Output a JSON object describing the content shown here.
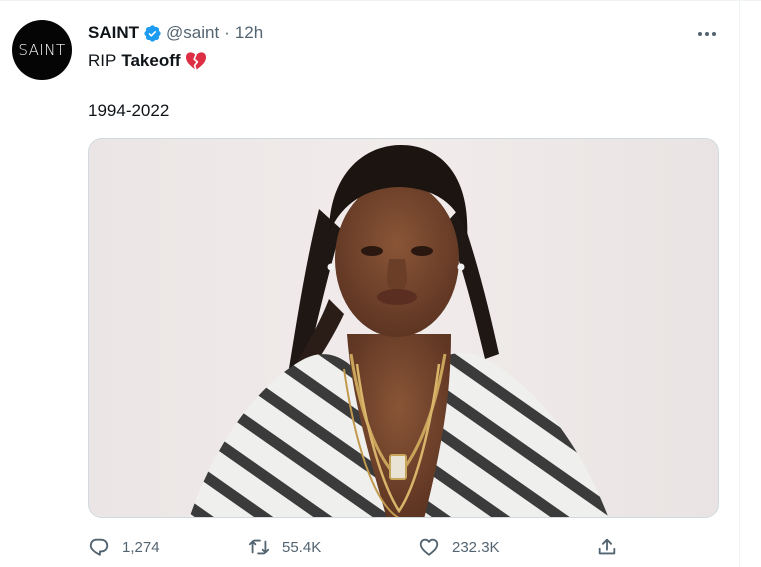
{
  "tweet": {
    "avatar_text": "SAINT",
    "display_name": "SAINT",
    "handle": "@saint",
    "separator": "·",
    "time": "12h",
    "text_prefix": "RIP",
    "text_bold": "Takeoff",
    "text_line2": "1994-2022"
  },
  "actions": {
    "replies": "1,274",
    "retweets": "55.4K",
    "likes": "232.3K"
  },
  "icons": {
    "verified": "verified-badge-icon",
    "emoji": "broken-heart-icon",
    "more": "more-dots-icon",
    "reply": "reply-icon",
    "retweet": "retweet-icon",
    "like": "like-icon",
    "share": "share-icon"
  },
  "colors": {
    "verified_blue": "#1d9bf0",
    "secondary_text": "#536471",
    "broken_heart": "#dd2e44"
  }
}
